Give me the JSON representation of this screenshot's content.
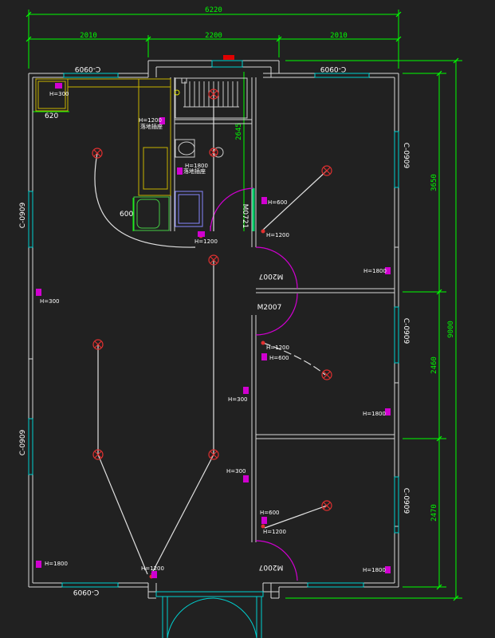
{
  "dimensions": {
    "overall_width": "6220",
    "left_bay": "2010",
    "mid_bay": "2200",
    "right_bay": "2010",
    "overall_depth": "9000",
    "depth_a": "3650",
    "depth_b": "2460",
    "depth_c": "2470",
    "bath_depth": "2645",
    "sink_width": "620",
    "counter_depth": "600"
  },
  "windows": {
    "top_left": "C-0909",
    "top_right": "C-0909",
    "left_upper": "C-0909",
    "left_lower": "C-0909",
    "right_upper": "C-0909",
    "right_mid": "C-0909",
    "right_lower": "C-0909",
    "bottom_left": "C-0909"
  },
  "doors": {
    "bath": "M0721",
    "bed1": "M2007",
    "bed1_b": "M2007",
    "bed3": "M2007",
    "corridor": "M2007"
  },
  "heights": {
    "h300": "H=300",
    "h600": "H=600",
    "h1200": "H=1200",
    "h1800": "H=1800"
  },
  "notes": {
    "appliance_a": "落地插座",
    "appliance_b": "落地插座"
  }
}
